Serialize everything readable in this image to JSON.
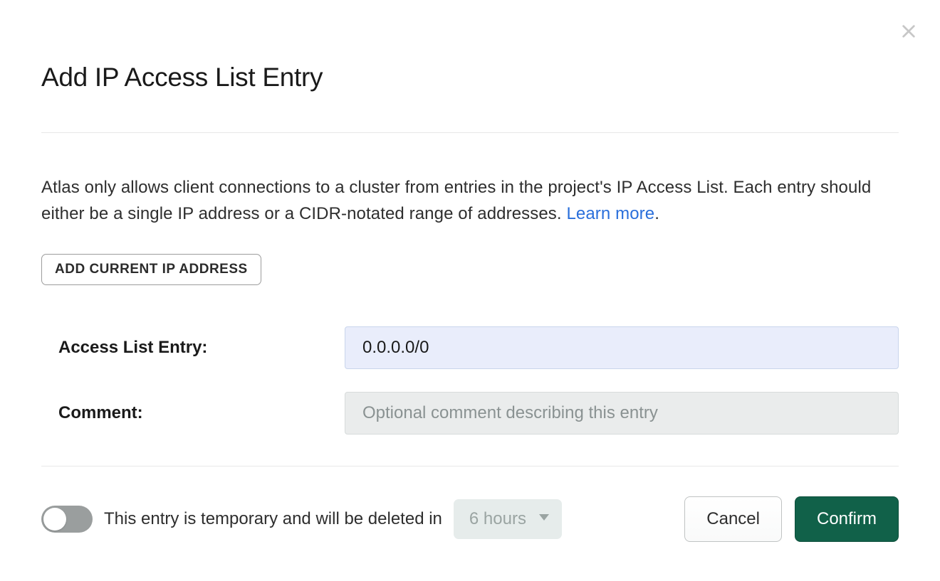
{
  "modal": {
    "title": "Add IP Access List Entry",
    "description_text": "Atlas only allows client connections to a cluster from entries in the project's IP Access List. Each entry should either be a single IP address or a CIDR-notated range of addresses. ",
    "learn_more": "Learn more",
    "period": "."
  },
  "buttons": {
    "add_current_ip": "ADD CURRENT IP ADDRESS",
    "cancel": "Cancel",
    "confirm": "Confirm"
  },
  "form": {
    "entry_label": "Access List Entry:",
    "entry_value": "0.0.0.0/0",
    "comment_label": "Comment:",
    "comment_value": "",
    "comment_placeholder": "Optional comment describing this entry"
  },
  "temporary": {
    "label": "This entry is temporary and will be deleted in",
    "duration": "6 hours",
    "enabled": false
  }
}
